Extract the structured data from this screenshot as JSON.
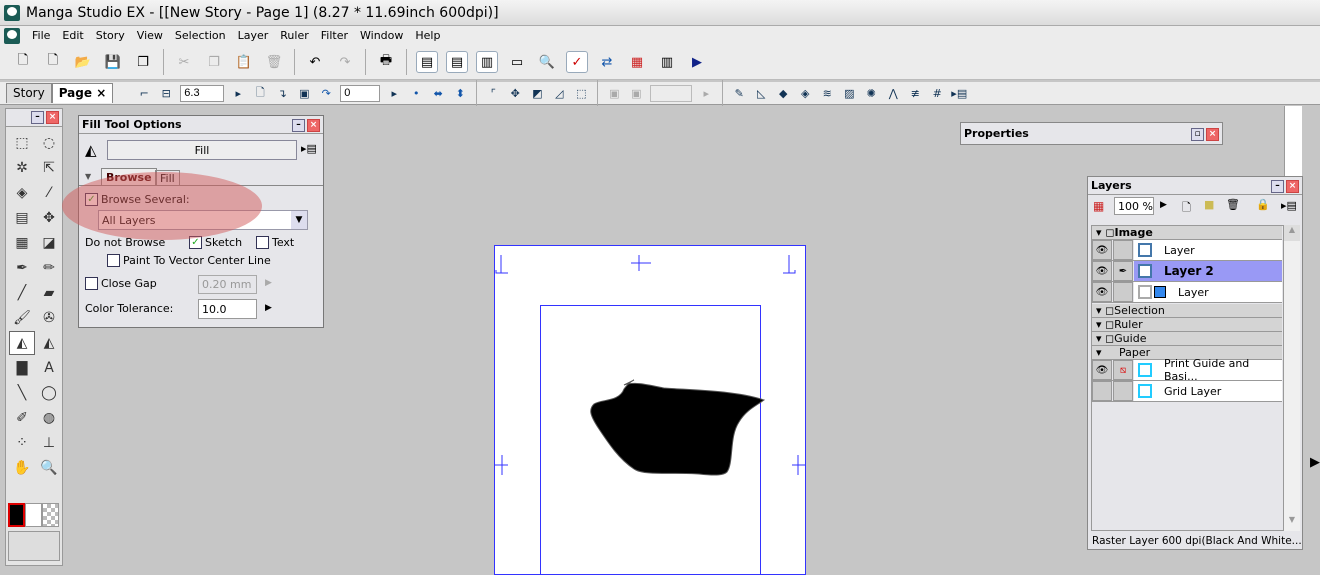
{
  "window": {
    "title": "Manga Studio EX - [[New Story - Page 1] (8.27 * 11.69inch 600dpi)]"
  },
  "menu": [
    "File",
    "Edit",
    "Story",
    "View",
    "Selection",
    "Layer",
    "Ruler",
    "Filter",
    "Window",
    "Help"
  ],
  "pagebar": {
    "tabs": [
      "Story",
      "Page"
    ],
    "close": "×",
    "value1": "6.3",
    "value2": "0"
  },
  "fill_panel": {
    "title": "Fill Tool Options",
    "tool_name": "Fill",
    "tabs": [
      "Browse",
      "Fill"
    ],
    "browse_several": "Browse Several:",
    "browse_several_checked": true,
    "layers_select": "All Layers",
    "do_not_browse": "Do not Browse",
    "sketch": "Sketch",
    "sketch_checked": true,
    "text": "Text",
    "text_checked": false,
    "paint_vector": "Paint To Vector Center Line",
    "close_gap": "Close Gap",
    "close_gap_value": "0.20 mm",
    "color_tolerance": "Color Tolerance:",
    "color_tolerance_value": "10.0"
  },
  "properties": {
    "title": "Properties"
  },
  "layers": {
    "title": "Layers",
    "opacity": "100 %",
    "groups": {
      "image": "Image",
      "selection": "Selection",
      "ruler": "Ruler",
      "guide": "Guide",
      "paper": "Paper"
    },
    "image_layers": [
      "Layer",
      "Layer 2",
      "Layer"
    ],
    "paper_layers": [
      "Print Guide and Basi...",
      "Grid Layer"
    ],
    "status": "Raster Layer 600 dpi(Black And White..."
  }
}
